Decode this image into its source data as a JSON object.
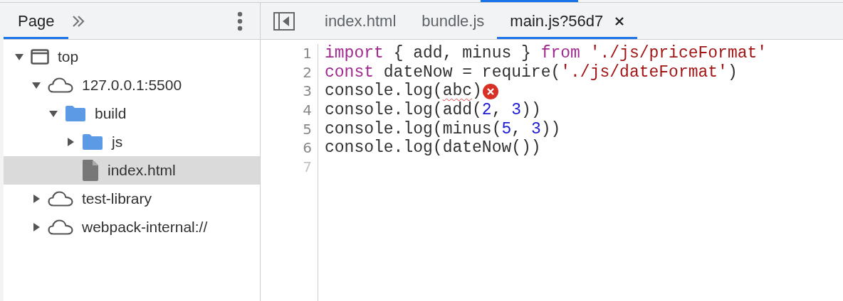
{
  "navigator": {
    "tabs": [
      {
        "label": "Page",
        "selected": true
      }
    ],
    "tree": [
      {
        "label": "top",
        "kind": "frame",
        "expanded": true,
        "selected": false,
        "children": [
          {
            "label": "127.0.0.1:5500",
            "kind": "cloud",
            "expanded": true,
            "selected": false,
            "children": [
              {
                "label": "build",
                "kind": "folder",
                "expanded": true,
                "selected": false,
                "children": [
                  {
                    "label": "js",
                    "kind": "folder",
                    "expanded": false,
                    "selected": false
                  },
                  {
                    "label": "index.html",
                    "kind": "file",
                    "selected": true
                  }
                ]
              }
            ]
          },
          {
            "label": "test-library",
            "kind": "cloud",
            "expanded": false,
            "selected": false
          },
          {
            "label": "webpack-internal://",
            "kind": "cloud",
            "expanded": false,
            "selected": false
          }
        ]
      }
    ]
  },
  "editor": {
    "tabs": [
      {
        "label": "index.html",
        "selected": false,
        "closable": false
      },
      {
        "label": "bundle.js",
        "selected": false,
        "closable": false
      },
      {
        "label": "main.js?56d7",
        "selected": true,
        "closable": true
      }
    ],
    "lines": [
      {
        "number": "1",
        "beyond_end": false,
        "error": false,
        "tokens": [
          {
            "kind": "keyword",
            "text": "import"
          },
          {
            "kind": "plain",
            "text": " { add, minus } "
          },
          {
            "kind": "keyword",
            "text": "from"
          },
          {
            "kind": "string",
            "text": " './js/priceFormat'"
          }
        ]
      },
      {
        "number": "2",
        "beyond_end": false,
        "error": false,
        "tokens": [
          {
            "kind": "keyword",
            "text": "const"
          },
          {
            "kind": "plain",
            "text": " dateNow = require("
          },
          {
            "kind": "string",
            "text": "'./js/dateFormat'"
          },
          {
            "kind": "plain",
            "text": ")"
          }
        ]
      },
      {
        "number": "3",
        "beyond_end": false,
        "error": true,
        "tokens": [
          {
            "kind": "plain",
            "text": "console.log("
          },
          {
            "kind": "squiggle",
            "text": "abc"
          },
          {
            "kind": "plain",
            "text": ")"
          }
        ]
      },
      {
        "number": "4",
        "beyond_end": false,
        "error": false,
        "tokens": [
          {
            "kind": "plain",
            "text": "console.log(add("
          },
          {
            "kind": "number",
            "text": "2"
          },
          {
            "kind": "plain",
            "text": ", "
          },
          {
            "kind": "number",
            "text": "3"
          },
          {
            "kind": "plain",
            "text": "))"
          }
        ]
      },
      {
        "number": "5",
        "beyond_end": false,
        "error": false,
        "tokens": [
          {
            "kind": "plain",
            "text": "console.log(minus("
          },
          {
            "kind": "number",
            "text": "5"
          },
          {
            "kind": "plain",
            "text": ", "
          },
          {
            "kind": "number",
            "text": "3"
          },
          {
            "kind": "plain",
            "text": "))"
          }
        ]
      },
      {
        "number": "6",
        "beyond_end": false,
        "error": false,
        "tokens": [
          {
            "kind": "plain",
            "text": "console.log(dateNow())"
          }
        ]
      },
      {
        "number": "7",
        "beyond_end": true,
        "error": false
      }
    ]
  }
}
